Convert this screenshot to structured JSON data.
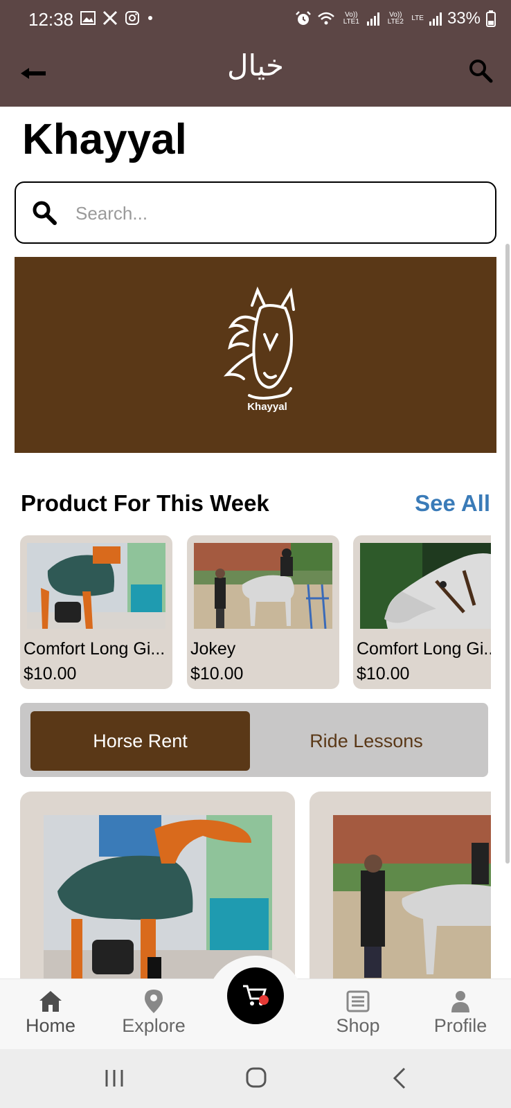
{
  "status_bar": {
    "time": "12:38",
    "net1": "Vo)) LTE1",
    "net2": "Vo)) LTE2",
    "lte": "LTE",
    "battery": "33%"
  },
  "app_bar": {
    "title": "خيال"
  },
  "page": {
    "title": "Khayyal",
    "search_placeholder": "Search..."
  },
  "banner": {
    "logo_text": "Khayyal",
    "color": "#5A3817"
  },
  "section": {
    "title": "Product For This Week",
    "see_all": "See All"
  },
  "products": [
    {
      "name": "Comfort Long Gi...",
      "price": "$10.00"
    },
    {
      "name": "Jokey",
      "price": "$10.00"
    },
    {
      "name": "Comfort Long Gi...",
      "price": "$10.00"
    }
  ],
  "segment": {
    "active": "Horse Rent",
    "inactive": "Ride Lessons"
  },
  "bottom_nav": {
    "home": "Home",
    "explore": "Explore",
    "shop": "Shop",
    "profile": "Profile"
  },
  "colors": {
    "app_bar": "#5C4645",
    "brand_brown": "#5A3817",
    "card_bg": "#DDD6CF",
    "link_blue": "#3A7BB8"
  },
  "icons": [
    "back-arrow-icon",
    "search-icon",
    "home-icon",
    "location-pin-icon",
    "cart-icon",
    "list-icon",
    "person-icon"
  ]
}
